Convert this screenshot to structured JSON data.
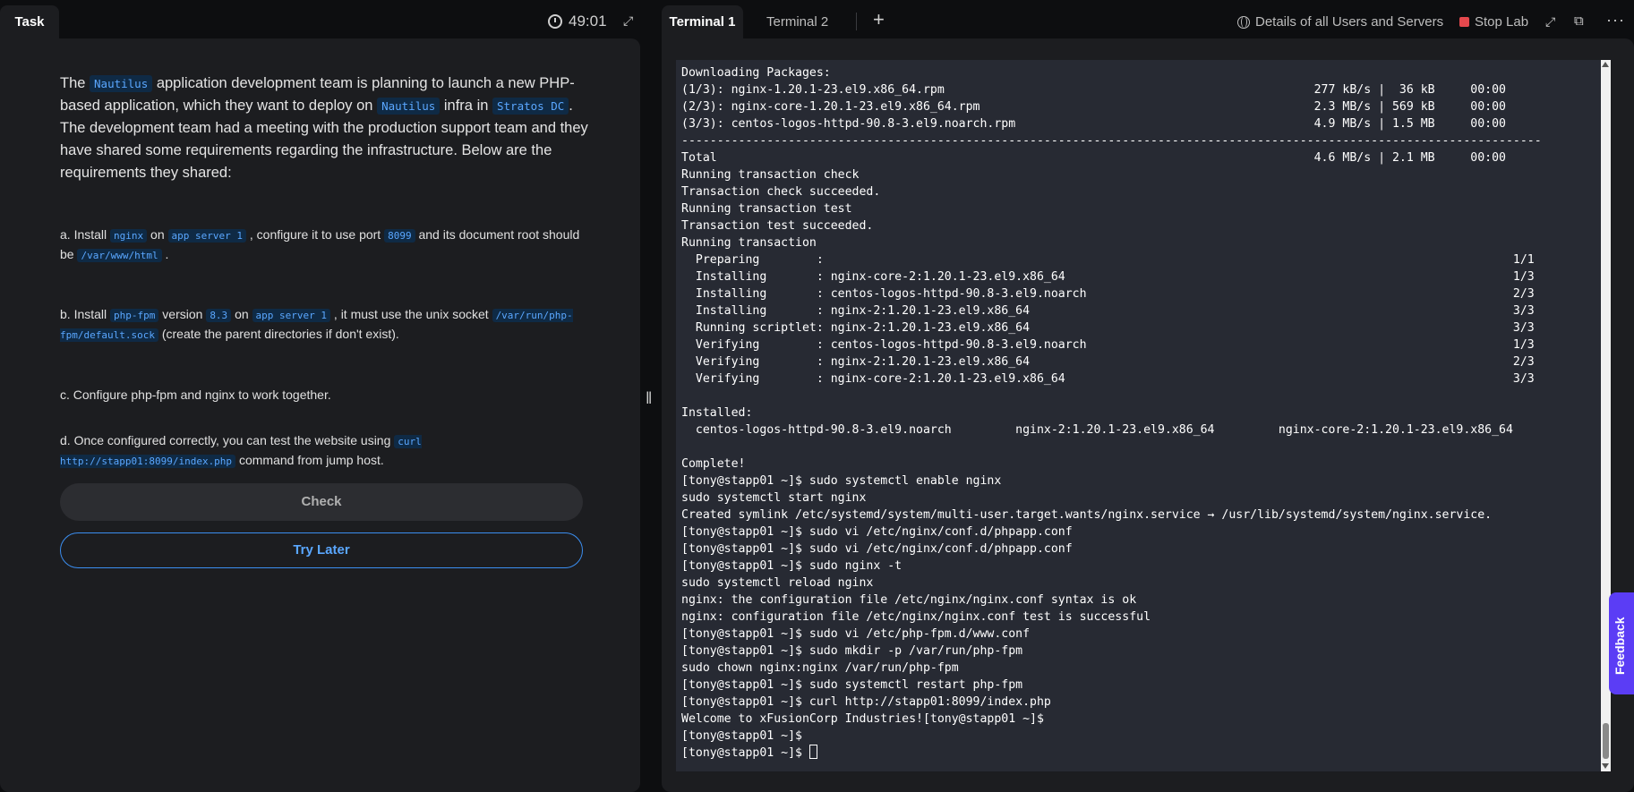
{
  "task_panel": {
    "tab_label": "Task",
    "timer": "49:01",
    "intro": [
      {
        "t": "The "
      },
      {
        "c": "Nautilus"
      },
      {
        "t": " application development team is planning to launch a new PHP-based application, which they want to deploy on "
      },
      {
        "c": "Nautilus"
      },
      {
        "t": " infra in "
      },
      {
        "c": "Stratos DC"
      },
      {
        "t": ". The development team had a meeting with the production support team and they have shared some requirements regarding the infrastructure. Below are the requirements they shared:"
      }
    ],
    "requirements": [
      [
        {
          "t": "a. Install "
        },
        {
          "c": "nginx"
        },
        {
          "t": " on "
        },
        {
          "c": "app server 1"
        },
        {
          "t": " , configure it to use port "
        },
        {
          "c": "8099"
        },
        {
          "t": " and its document root should be "
        },
        {
          "c": "/var/www/html"
        },
        {
          "t": " ."
        }
      ],
      [
        {
          "t": "b. Install "
        },
        {
          "c": "php-fpm"
        },
        {
          "t": " version "
        },
        {
          "c": "8.3"
        },
        {
          "t": " on "
        },
        {
          "c": "app server 1"
        },
        {
          "t": " , it must use the unix socket "
        },
        {
          "c": "/var/run/php-fpm/default.sock"
        },
        {
          "t": " (create the parent directories if don't exist)."
        }
      ],
      [
        {
          "t": "c. Configure php-fpm and nginx to work together."
        }
      ],
      [
        {
          "t": "d. Once configured correctly, you can test the website using "
        },
        {
          "c": "curl http://stapp01:8099/index.php"
        },
        {
          "t": " command from jump host."
        }
      ]
    ],
    "check_label": "Check",
    "try_later_label": "Try Later"
  },
  "terminal_panel": {
    "tabs": [
      "Terminal 1",
      "Terminal 2"
    ],
    "add_tab": "+",
    "details_label": "Details of all Users and Servers",
    "stop_label": "Stop Lab",
    "lines": [
      "Downloading Packages:",
      "(1/3): nginx-1.20.1-23.el9.x86_64.rpm                                                    277 kB/s |  36 kB     00:00",
      "(2/3): nginx-core-1.20.1-23.el9.x86_64.rpm                                               2.3 MB/s | 569 kB     00:00",
      "(3/3): centos-logos-httpd-90.8-3.el9.noarch.rpm                                          4.9 MB/s | 1.5 MB     00:00",
      "-------------------------------------------------------------------------------------------------------------------------",
      "Total                                                                                    4.6 MB/s | 2.1 MB     00:00",
      "Running transaction check",
      "Transaction check succeeded.",
      "Running transaction test",
      "Transaction test succeeded.",
      "Running transaction",
      "  Preparing        :                                                                                                 1/1",
      "  Installing       : nginx-core-2:1.20.1-23.el9.x86_64                                                               1/3",
      "  Installing       : centos-logos-httpd-90.8-3.el9.noarch                                                            2/3",
      "  Installing       : nginx-2:1.20.1-23.el9.x86_64                                                                    3/3",
      "  Running scriptlet: nginx-2:1.20.1-23.el9.x86_64                                                                    3/3",
      "  Verifying        : centos-logos-httpd-90.8-3.el9.noarch                                                            1/3",
      "  Verifying        : nginx-2:1.20.1-23.el9.x86_64                                                                    2/3",
      "  Verifying        : nginx-core-2:1.20.1-23.el9.x86_64                                                               3/3",
      "",
      "Installed:",
      "  centos-logos-httpd-90.8-3.el9.noarch         nginx-2:1.20.1-23.el9.x86_64         nginx-core-2:1.20.1-23.el9.x86_64",
      "",
      "Complete!",
      "[tony@stapp01 ~]$ sudo systemctl enable nginx",
      "sudo systemctl start nginx",
      "Created symlink /etc/systemd/system/multi-user.target.wants/nginx.service → /usr/lib/systemd/system/nginx.service.",
      "[tony@stapp01 ~]$ sudo vi /etc/nginx/conf.d/phpapp.conf",
      "[tony@stapp01 ~]$ sudo vi /etc/nginx/conf.d/phpapp.conf",
      "[tony@stapp01 ~]$ sudo nginx -t",
      "sudo systemctl reload nginx",
      "nginx: the configuration file /etc/nginx/nginx.conf syntax is ok",
      "nginx: configuration file /etc/nginx/nginx.conf test is successful",
      "[tony@stapp01 ~]$ sudo vi /etc/php-fpm.d/www.conf",
      "[tony@stapp01 ~]$ sudo mkdir -p /var/run/php-fpm",
      "sudo chown nginx:nginx /var/run/php-fpm",
      "[tony@stapp01 ~]$ sudo systemctl restart php-fpm",
      "[tony@stapp01 ~]$ curl http://stapp01:8099/index.php",
      "Welcome to xFusionCorp Industries![tony@stapp01 ~]$",
      "[tony@stapp01 ~]$",
      "[tony@stapp01 ~]$ "
    ]
  },
  "feedback_label": "Feedback",
  "colors": {
    "accent": "#3b8ef0",
    "code_bg": "#0f2a45",
    "stop": "#e5484d",
    "feedback": "#5b3df5"
  }
}
